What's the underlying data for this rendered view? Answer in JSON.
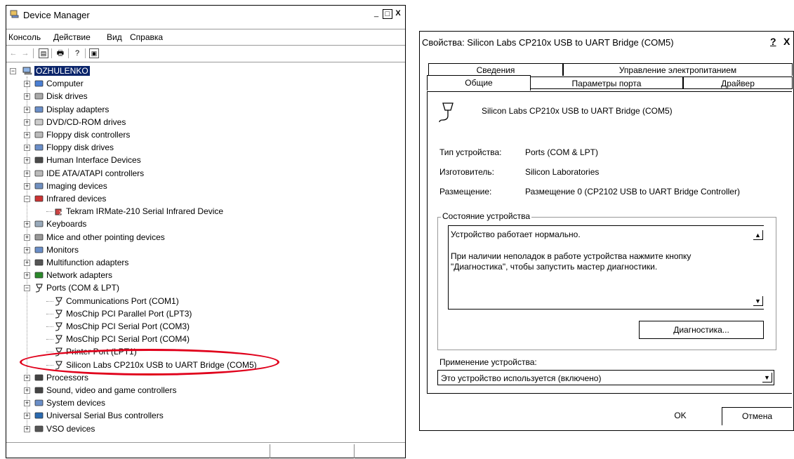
{
  "device_manager": {
    "title": "Device Manager",
    "window_buttons": {
      "minimize": "_",
      "maximize": "□",
      "close": "X"
    },
    "menu": [
      "Консоль",
      "Действие",
      "Вид",
      "Справка"
    ],
    "tree": {
      "root": "OZHULENKO",
      "categories": [
        {
          "label": "Computer",
          "icon": "computer-icon",
          "expanded": false
        },
        {
          "label": "Disk drives",
          "icon": "disk-drive-icon",
          "expanded": false
        },
        {
          "label": "Display adapters",
          "icon": "display-adapter-icon",
          "expanded": false
        },
        {
          "label": "DVD/CD-ROM drives",
          "icon": "dvd-drive-icon",
          "expanded": false
        },
        {
          "label": "Floppy disk controllers",
          "icon": "floppy-controller-icon",
          "expanded": false
        },
        {
          "label": "Floppy disk drives",
          "icon": "floppy-drive-icon",
          "expanded": false
        },
        {
          "label": "Human Interface Devices",
          "icon": "hid-icon",
          "expanded": false
        },
        {
          "label": "IDE ATA/ATAPI controllers",
          "icon": "ide-controller-icon",
          "expanded": false
        },
        {
          "label": "Imaging devices",
          "icon": "camera-icon",
          "expanded": false
        },
        {
          "label": "Infrared devices",
          "icon": "infrared-icon",
          "expanded": true
        },
        {
          "label": "Tekram IRMate-210 Serial Infrared Device",
          "icon": "infrared-device-error-icon",
          "child": true
        },
        {
          "label": "Keyboards",
          "icon": "keyboard-icon",
          "expanded": false
        },
        {
          "label": "Mice and other pointing devices",
          "icon": "mouse-icon",
          "expanded": false
        },
        {
          "label": "Monitors",
          "icon": "monitor-icon",
          "expanded": false
        },
        {
          "label": "Multifunction adapters",
          "icon": "multifunction-icon",
          "expanded": false
        },
        {
          "label": "Network adapters",
          "icon": "network-adapter-icon",
          "expanded": false
        },
        {
          "label": "Ports (COM & LPT)",
          "icon": "port-icon",
          "expanded": true
        },
        {
          "label": "Communications Port (COM1)",
          "icon": "port-icon",
          "child": true
        },
        {
          "label": "MosChip PCI Parallel Port (LPT3)",
          "icon": "port-icon",
          "child": true
        },
        {
          "label": "MosChip PCI Serial Port (COM3)",
          "icon": "port-icon",
          "child": true
        },
        {
          "label": "MosChip PCI Serial Port (COM4)",
          "icon": "port-icon",
          "child": true
        },
        {
          "label": "Printer Port (LPT1)",
          "icon": "port-icon",
          "child": true
        },
        {
          "label": "Silicon Labs CP210x USB to UART Bridge (COM5)",
          "icon": "port-icon",
          "child": true,
          "highlighted": true
        },
        {
          "label": "Processors",
          "icon": "processor-icon",
          "expanded": false
        },
        {
          "label": "Sound, video and game controllers",
          "icon": "sound-icon",
          "expanded": false
        },
        {
          "label": "System devices",
          "icon": "system-device-icon",
          "expanded": false
        },
        {
          "label": "Universal Serial Bus controllers",
          "icon": "usb-icon",
          "expanded": false
        },
        {
          "label": "VSO devices",
          "icon": "vso-icon",
          "expanded": false
        }
      ]
    },
    "highlight_color": "#e0001b"
  },
  "properties_dialog": {
    "title": "Свойства: Silicon Labs CP210x USB to UART Bridge (COM5)",
    "title_buttons": {
      "help": "?",
      "close": "X"
    },
    "tabs_back": [
      "Сведения",
      "Управление электропитанием"
    ],
    "tabs_front": [
      "Общие",
      "Параметры порта",
      "Драйвер"
    ],
    "active_tab": "Общие",
    "device_name": "Silicon Labs CP210x USB to UART Bridge (COM5)",
    "fields": [
      {
        "label": "Тип устройства:",
        "value": "Ports (COM & LPT)"
      },
      {
        "label": "Изготовитель:",
        "value": "Silicon Laboratories"
      },
      {
        "label": "Размещение:",
        "value": "Размещение 0 (CP2102 USB to UART Bridge Controller)"
      }
    ],
    "status_group_title": "Состояние устройства",
    "status_text_1": "Устройство работает нормально.",
    "status_text_2": "При наличии неполадок в работе устройства нажмите кнопку",
    "status_text_3": "\"Диагностика\", чтобы запустить мастер диагностики.",
    "diagnostics_button": "Диагностика...",
    "usage_label": "Применение устройства:",
    "usage_value": "Это устройство используется (включено)",
    "ok_button": "OK",
    "cancel_button": "Отмена"
  }
}
